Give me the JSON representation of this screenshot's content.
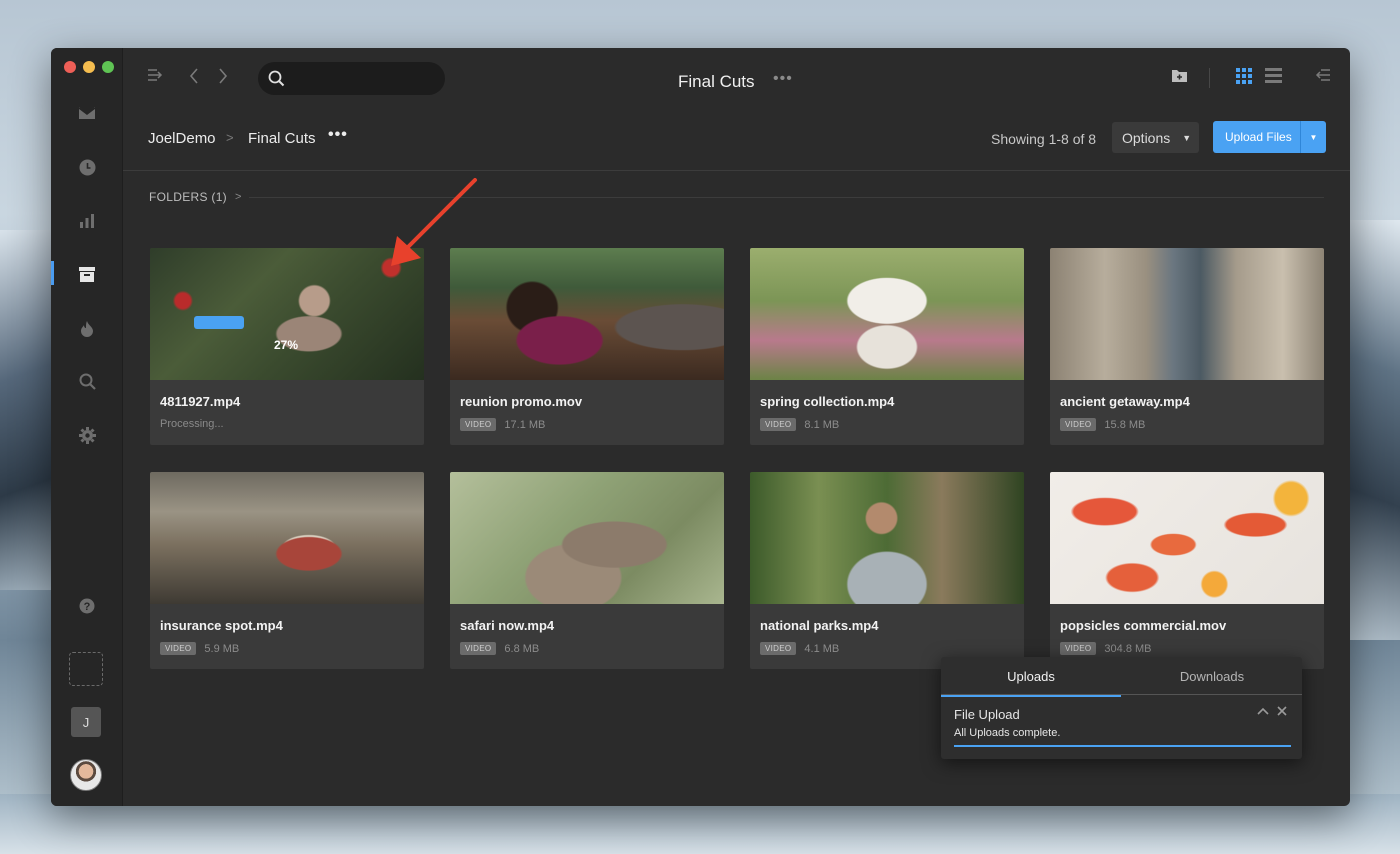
{
  "window": {
    "title": "Final Cuts",
    "title_more": "•••"
  },
  "sidebar": {
    "items": [
      {
        "icon": "inbox-icon"
      },
      {
        "icon": "clock-icon"
      },
      {
        "icon": "bar-chart-icon"
      },
      {
        "icon": "archive-icon",
        "active": true
      },
      {
        "icon": "flame-icon"
      },
      {
        "icon": "search-icon"
      },
      {
        "icon": "gear-icon"
      }
    ],
    "help_icon": "help-icon",
    "user_initial": "J"
  },
  "toolbar": {
    "search_placeholder": "",
    "icons": [
      "collapse-sidebar-icon",
      "back-icon",
      "forward-icon",
      "new-folder-icon",
      "grid-view-icon",
      "list-view-icon",
      "panel-toggle-icon"
    ]
  },
  "breadcrumb": {
    "items": [
      "JoelDemo",
      "Final Cuts"
    ],
    "separator": ">",
    "more": "•••"
  },
  "header": {
    "showing": "Showing 1-8 of 8",
    "options_label": "Options",
    "upload_label": "Upload Files"
  },
  "folders": {
    "label": "FOLDERS (1)"
  },
  "files": [
    {
      "name": "4811927.mp4",
      "status": "Processing...",
      "progress": "27%",
      "progress_value": 0.27
    },
    {
      "name": "reunion promo.mov",
      "type": "VIDEO",
      "size": "17.1 MB"
    },
    {
      "name": "spring collection.mp4",
      "type": "VIDEO",
      "size": "8.1 MB"
    },
    {
      "name": "ancient getaway.mp4",
      "type": "VIDEO",
      "size": "15.8 MB"
    },
    {
      "name": "insurance spot.mp4",
      "type": "VIDEO",
      "size": "5.9 MB"
    },
    {
      "name": "safari now.mp4",
      "type": "VIDEO",
      "size": "6.8 MB"
    },
    {
      "name": "national parks.mp4",
      "type": "VIDEO",
      "size": "4.1 MB"
    },
    {
      "name": "popsicles commercial.mov",
      "type": "VIDEO",
      "size": "304.8 MB"
    }
  ],
  "transfers": {
    "tabs": [
      "Uploads",
      "Downloads"
    ],
    "active_tab": "Uploads",
    "title": "File Upload",
    "subtitle": "All Uploads complete."
  },
  "colors": {
    "accent": "#4aa2f3",
    "annotation_arrow": "#e8412c",
    "window_bg": "#2b2b2b"
  }
}
